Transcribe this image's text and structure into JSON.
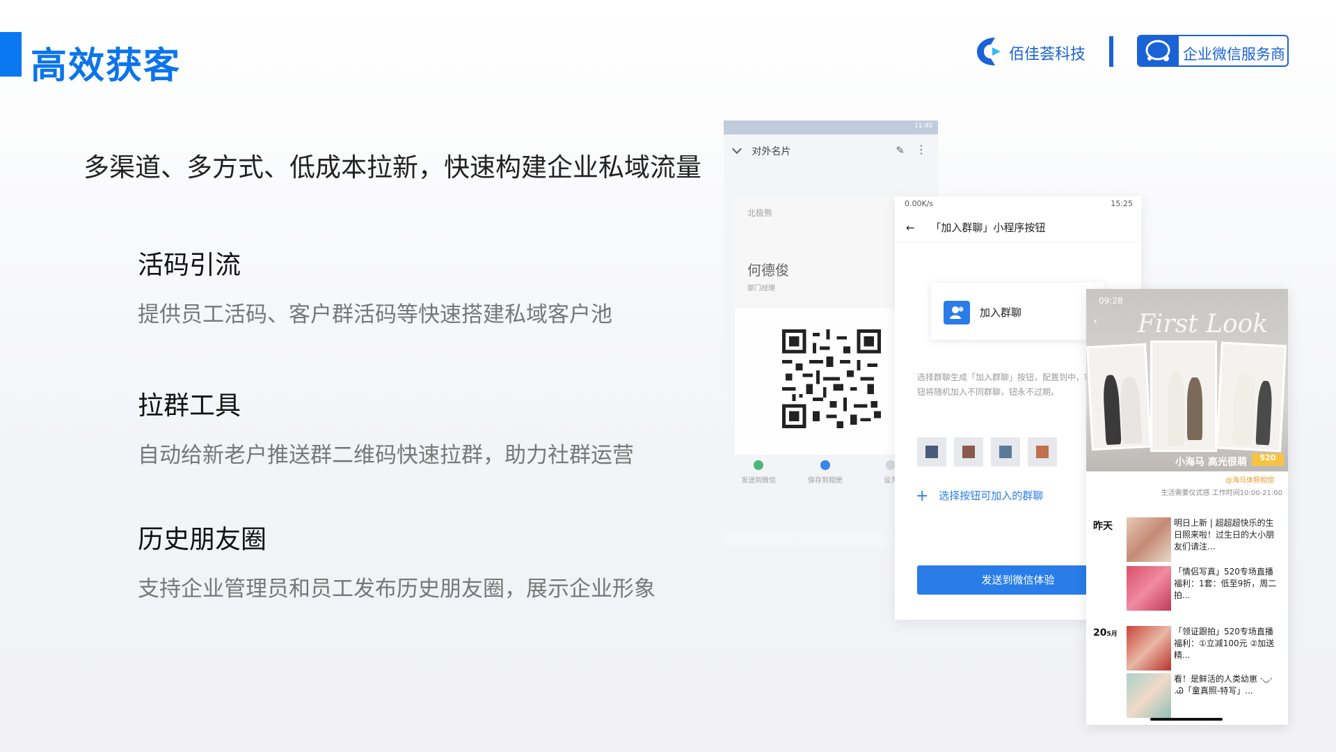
{
  "header": {
    "title": "高效获客",
    "brand_name": "佰佳荟科技",
    "badge_text": "企业微信服务商"
  },
  "subtitle": "多渠道、多方式、低成本拉新，快速构建企业私域流量",
  "features": [
    {
      "title": "活码引流",
      "desc": "提供员工活码、客户群活码等快速搭建私域客户池"
    },
    {
      "title": "拉群工具",
      "desc": "自动给新老户推送群二维码快速拉群，助力社群运营"
    },
    {
      "title": "历史朋友圈",
      "desc": "支持企业管理员和员工发布历史朋友圈，展示企业形象"
    }
  ],
  "card_contact": {
    "status_time": "11:40",
    "bar_title": "对外名片",
    "company": "北极熊",
    "person": "何德俊",
    "role": "部门经理",
    "actions": [
      "发送到微信",
      "保存到相册",
      "设为"
    ]
  },
  "card_group": {
    "status_speed": "0.00K/s",
    "status_time": "15:25",
    "bar_title": "「加入群聊」小程序按钮",
    "join_label": "加入群聊",
    "note": "选择群聊生成「加入群聊」按钮，配置到中，客户点击按钮将随机加入不同群聊，钮永不过期。",
    "add_label": "选择按钮可加入的群聊",
    "send_button": "发送到微信体验"
  },
  "card_moments": {
    "status_time": "09:28",
    "banner": "First Look",
    "caption": "小海马 高光很萌",
    "price": "520",
    "studio": "@海马体照相馆",
    "hours": "生活需要仪式感 工作时间10:00-21:00",
    "day1": "昨天",
    "day2": "20",
    "day2_month": "5月",
    "posts": [
      "明日上新 | 超超超快乐的生日照来啦！过生日的大小朋友们请注...",
      "「情侣写真」520专场直播福利：1套：低至9折，周二拍...",
      "「领证跟拍」520专场直播福利：①立减100元 ②加送精...",
      "看！是鲜活的人类幼崽 ·◡· .Ꮚ「童真照-特写」..."
    ]
  },
  "colors": {
    "accent": "#0a78f0",
    "brand": "#1a62d6",
    "button_blue": "#2a7de8"
  }
}
